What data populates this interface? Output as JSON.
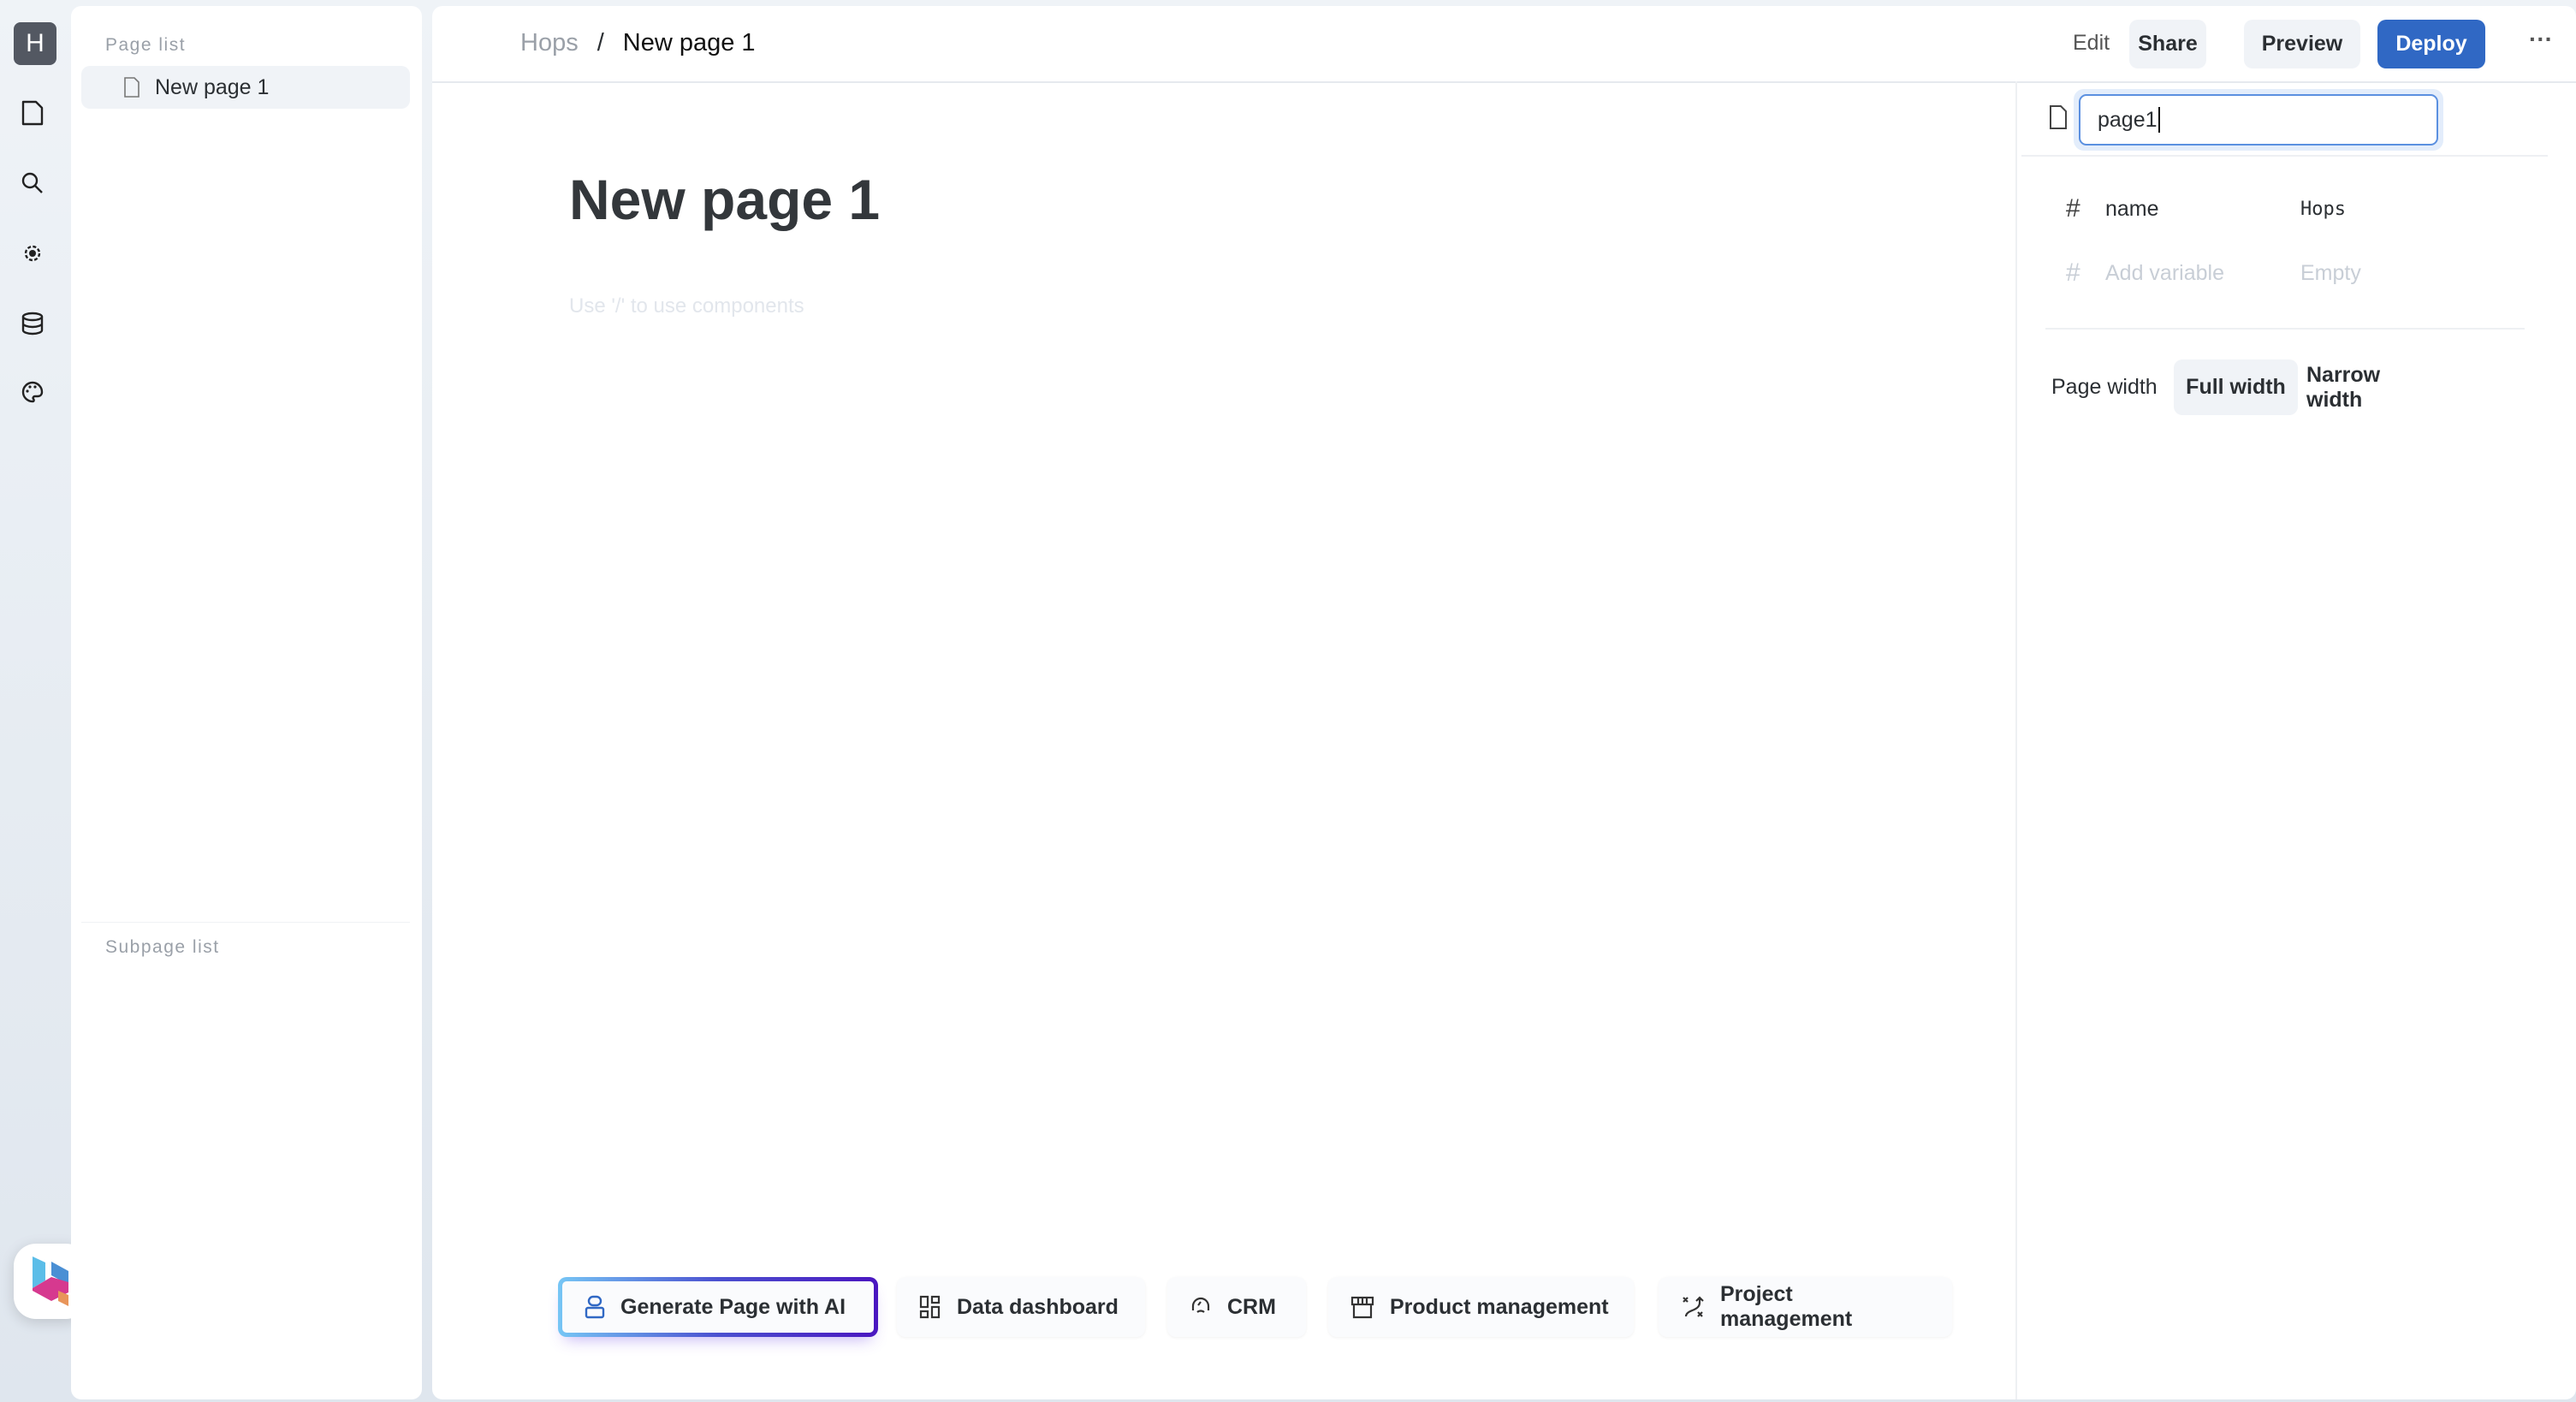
{
  "rail": {
    "avatar_letter": "H",
    "icons": [
      "document-icon",
      "search-icon",
      "gear-icon",
      "database-icon",
      "palette-icon"
    ],
    "logo": "H"
  },
  "page_list": {
    "title": "Page list",
    "items": [
      {
        "label": "New page 1"
      }
    ],
    "subpage_title": "Subpage list"
  },
  "header": {
    "breadcrumb": [
      "Hops",
      "/",
      "New page 1"
    ],
    "edit_label": "Edit",
    "share_label": "Share",
    "preview_label": "Preview",
    "deploy_label": "Deploy",
    "more": "···"
  },
  "editor": {
    "title": "New page 1",
    "placeholder": "Use '/' to use components"
  },
  "templates": [
    {
      "label": "Generate Page with AI",
      "icon": "robot-icon"
    },
    {
      "label": "Data dashboard",
      "icon": "dashboard-icon"
    },
    {
      "label": "CRM",
      "icon": "headset-icon"
    },
    {
      "label": "Product management",
      "icon": "store-icon"
    },
    {
      "label": "Project management",
      "icon": "route-icon"
    }
  ],
  "inspector": {
    "page_id": "page1",
    "variables": [
      {
        "name": "name",
        "value": "Hops"
      }
    ],
    "add_variable": "Add variable",
    "add_value": "Empty",
    "page_width_label": "Page width",
    "width_options": [
      "Full width",
      "Narrow width"
    ],
    "selected_width": "Full width"
  },
  "colors": {
    "accent": "#3068c4",
    "avatar": "#535862"
  }
}
